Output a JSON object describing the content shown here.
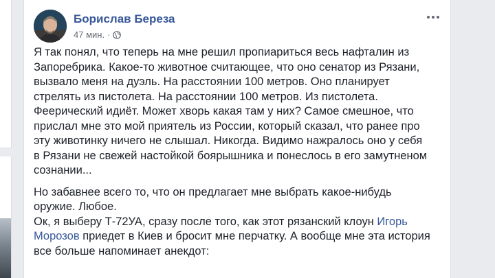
{
  "post": {
    "author": "Борислав Береза",
    "timestamp": "47 мин.",
    "separator": "·",
    "privacy_icon": "globe-icon",
    "menu_icon": "more-dots-icon",
    "paragraph1": [
      "Я так понял, что теперь на мне решил пропиариться весь нафталин из",
      "Запоребрика. Какое-то животное считающее, что оно сенатор из Рязани,",
      "вызвало меня на дуэль. На расстоянии 100 метров. Оно планирует",
      "стрелять из пистолета. На расстоянии 100 метров. Из пистолета.",
      "Феерический идиёт. Может хворь какая там у них? Самое смешное, что",
      "прислал мне это мой приятель из России, который сказал, что ранее про",
      "эту животинку ничего не слышал. Никогда. Видимо нажралось оно у себя",
      "в Рязани не свежей настойкой боярышника и понеслось в его замутненом",
      "сознании..."
    ],
    "paragraph2": {
      "line1": "Но забавнее всего то, что он предлагает мне выбрать какое-нибудь",
      "line2": "оружие. Любое.",
      "line3_before": "Ок, я выберу Т-72УА, сразу после того, как этот рязанский клоун ",
      "line3_link": "Игорь",
      "line4_link": "Морозов",
      "line4_after": " приедет в Киев и бросит мне перчатку. А вообще мне эта история",
      "line5": "все больше напоминает анекдот:"
    }
  },
  "colors": {
    "background": "#e9ebee",
    "author": "#365899",
    "link": "#365899",
    "text": "#1d2129",
    "meta": "#616770"
  }
}
